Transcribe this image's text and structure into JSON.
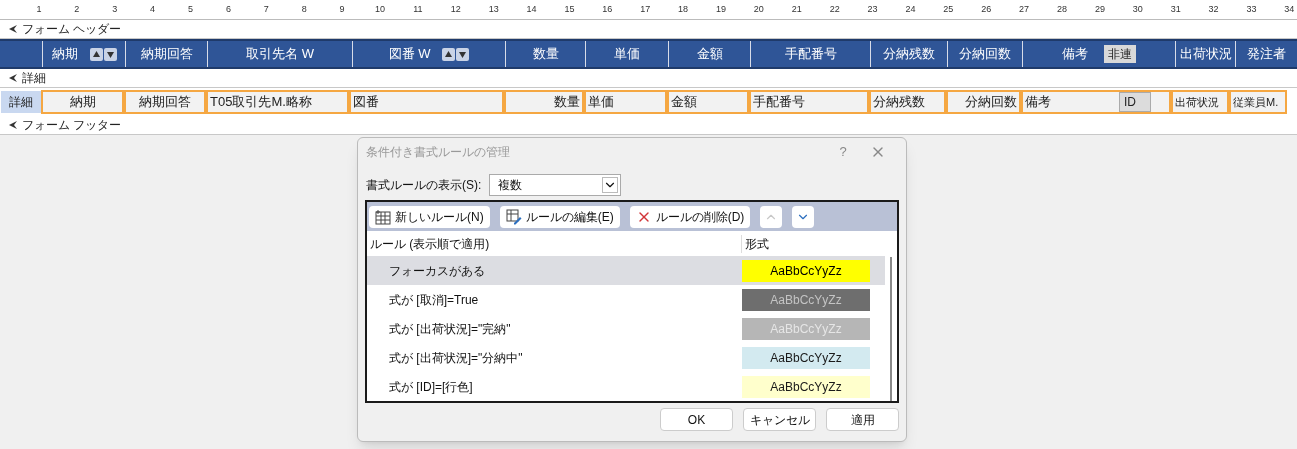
{
  "ruler": [
    "1",
    "2",
    "3",
    "4",
    "5",
    "6",
    "7",
    "8",
    "9",
    "10",
    "11",
    "12",
    "13",
    "14",
    "15",
    "16",
    "17",
    "18",
    "19",
    "20",
    "21",
    "22",
    "23",
    "24",
    "25",
    "26",
    "27",
    "28",
    "29",
    "30",
    "31",
    "32",
    "33",
    "34"
  ],
  "form_header": {
    "label": "フォーム ヘッダー",
    "columns": [
      {
        "label": "納期",
        "sortable": true
      },
      {
        "label": "納期回答",
        "sortable": false
      },
      {
        "label": "取引先名 W",
        "sortable": false
      },
      {
        "label": "図番 W",
        "sortable": true
      },
      {
        "label": "数量",
        "sortable": false
      },
      {
        "label": "単価",
        "sortable": false
      },
      {
        "label": "金額",
        "sortable": false
      },
      {
        "label": "手配番号",
        "sortable": false
      },
      {
        "label": "分納残数",
        "sortable": false
      },
      {
        "label": "分納回数",
        "sortable": false
      },
      {
        "label": "備考",
        "sortable": false,
        "button": "非連"
      },
      {
        "label": "出荷状況",
        "sortable": false
      },
      {
        "label": "発注者",
        "sortable": false
      }
    ]
  },
  "detail": {
    "label": "詳細",
    "selector": "詳細",
    "fields": [
      {
        "label": "納期"
      },
      {
        "label": "納期回答"
      },
      {
        "label": "T05取引先M.略称"
      },
      {
        "label": "図番"
      },
      {
        "label": "数量"
      },
      {
        "label": "単価"
      },
      {
        "label": "金額"
      },
      {
        "label": "手配番号"
      },
      {
        "label": "分納残数"
      },
      {
        "label": "分納回数"
      },
      {
        "label": "備考",
        "inner": "ID"
      },
      {
        "label": "出荷状況"
      },
      {
        "label": "従業員M."
      }
    ]
  },
  "form_footer": {
    "label": "フォーム フッター"
  },
  "dialog": {
    "title": "条件付き書式ルールの管理",
    "help": "?",
    "show_label": "書式ルールの表示(S):",
    "show_value": "複数",
    "toolbar": [
      {
        "kind": "new",
        "label": "新しいルール(N)"
      },
      {
        "kind": "edit",
        "label": "ルールの編集(E)"
      },
      {
        "kind": "delete",
        "label": "ルールの削除(D)"
      }
    ],
    "move_up": {
      "disabled": true
    },
    "move_down": {
      "disabled": false
    },
    "columns": [
      "ルール (表示順で適用)",
      "形式"
    ],
    "rules": [
      {
        "rule": "フォーカスがある",
        "preview": "AaBbCcYyZz",
        "color": "#ffff00",
        "selected": true
      },
      {
        "rule": "式が [取消]=True",
        "preview": "AaBbCcYyZz",
        "color": "#6e6e6e",
        "selected": false
      },
      {
        "rule": "式が [出荷状況]=\"完納\"",
        "preview": "AaBbCcYyZz",
        "color": "#b6b6b6",
        "selected": false
      },
      {
        "rule": "式が [出荷状況]=\"分納中\"",
        "preview": "AaBbCcYyZz",
        "color": "#d3eaf0",
        "selected": false
      },
      {
        "rule": "式が [ID]=[行色]",
        "preview": "AaBbCcYyZz",
        "color": "#ffffcc",
        "selected": false
      }
    ],
    "buttons": [
      "OK",
      "キャンセル",
      "適用"
    ]
  }
}
